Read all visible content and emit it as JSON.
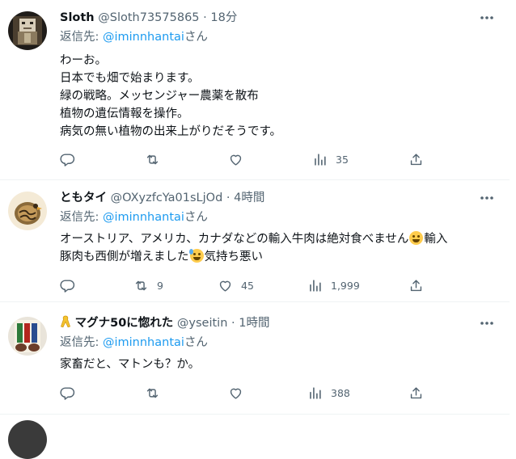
{
  "tweets": [
    {
      "name": "Sloth",
      "handle": "@Sloth73575865",
      "dot": "·",
      "time": "18分",
      "reply_prefix": "返信先: ",
      "reply_to": "@iminnhantai",
      "reply_suffix": "さん",
      "lines": [
        "わーお。",
        "日本でも畑で始まります。",
        "緑の戦略。メッセンジャー農薬を散布",
        "植物の遺伝情報を操作。",
        "病気の無い植物の出来上がりだそうです。"
      ],
      "counts": {
        "reply": "",
        "retweet": "",
        "like": "",
        "views": "35"
      }
    },
    {
      "name": "ともタイ",
      "handle": "@OXyzfcYa01sLjOd",
      "dot": "·",
      "time": "4時間",
      "reply_prefix": "返信先: ",
      "reply_to": "@iminnhantai",
      "reply_suffix": "さん",
      "text_a": "オーストリア、アメリカ、カナダなどの輸入牛肉は絶対食べません",
      "text_b": "輸入",
      "text_c": "豚肉も西側が増えました",
      "text_d": "気持ち悪い",
      "counts": {
        "reply": "",
        "retweet": "9",
        "like": "45",
        "views": "1,999"
      }
    },
    {
      "name": "マグナ50に惚れた",
      "handle": "@yseitin",
      "dot": "·",
      "time": "1時間",
      "reply_prefix": "返信先: ",
      "reply_to": "@iminnhantai",
      "reply_suffix": "さん",
      "lines": [
        "家畜だと、マトンも？か。"
      ],
      "counts": {
        "reply": "",
        "retweet": "",
        "like": "",
        "views": "388"
      }
    }
  ],
  "icons": {
    "more": "more-horizontal-icon",
    "reply": "reply-icon",
    "retweet": "retweet-icon",
    "like": "heart-icon",
    "views": "analytics-icon",
    "share": "share-icon",
    "ribbon": "yellow-ribbon-icon",
    "grin": "grinning-face-emoji",
    "sweat": "grinning-sweat-emoji"
  },
  "colors": {
    "text": "#0f1419",
    "secondary": "#536471",
    "link": "#1d9bf0",
    "separator": "#eff3f4"
  }
}
